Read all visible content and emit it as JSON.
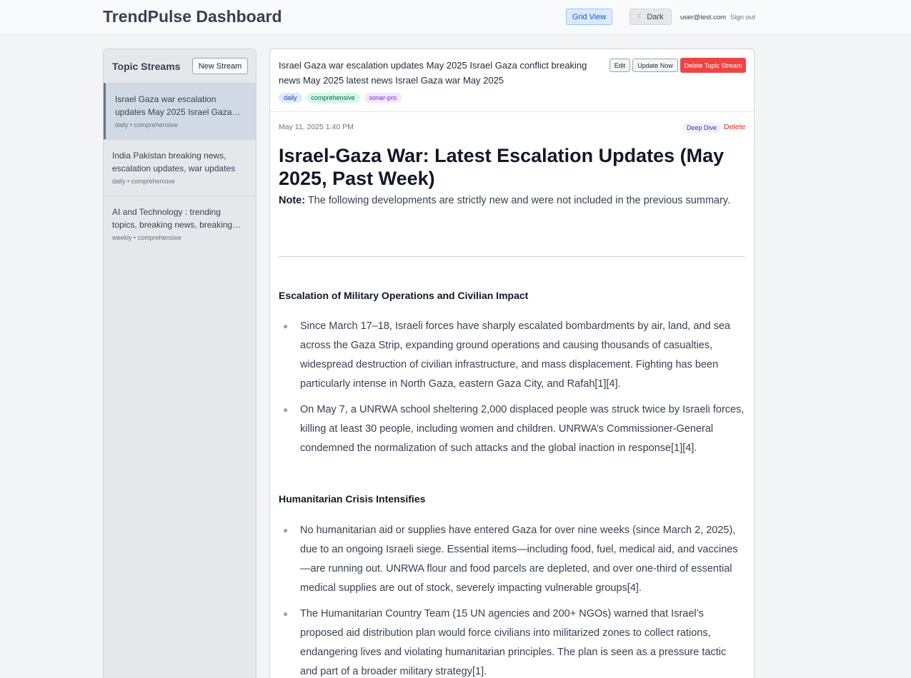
{
  "header": {
    "app_title": "TrendPulse Dashboard",
    "grid_view_label": "Grid View",
    "dark_label": "Dark",
    "user_email": "user@test.com",
    "sign_out_label": "Sign out"
  },
  "sidebar": {
    "title": "Topic Streams",
    "new_stream_label": "New Stream",
    "items": [
      {
        "title": "Israel Gaza war escalation updates May 2025 Israel Gaza conflict breaking news May 2025 latest news Israel Gaza war May 2025",
        "meta": "daily • comprehensive",
        "active": true
      },
      {
        "title": "India Pakistan breaking news, escalation updates, war updates",
        "meta": "daily • comprehensive",
        "active": false
      },
      {
        "title": "AI and Technology : trending topics, breaking news, breaking updates",
        "meta": "weekly • comprehensive",
        "active": false
      }
    ]
  },
  "main": {
    "title": "Israel Gaza war escalation updates May 2025 Israel Gaza conflict breaking news May 2025 latest news Israel Gaza war May 2025",
    "edit_label": "Edit",
    "update_label": "Update Now",
    "delete_topic_label": "Delete Topic Stream",
    "tags": [
      "daily",
      "comprehensive",
      "sonar-pro"
    ],
    "entry": {
      "date": "May 11, 2025 1:40 PM",
      "deep_dive_label": "Deep Dive",
      "delete_label": "Delete",
      "headline": "Israel-Gaza War: Latest Escalation Updates (May 2025, Past Week)",
      "note_label": "Note:",
      "note_text": " The following developments are strictly new and were not included in the previous summary.",
      "sections": [
        {
          "heading": "Escalation of Military Operations and Civilian Impact",
          "bullets": [
            "Since March 17–18, Israeli forces have sharply escalated bombardments by air, land, and sea across the Gaza Strip, expanding ground operations and causing thousands of casualties, widespread destruction of civilian infrastructure, and mass displacement. Fighting has been particularly intense in North Gaza, eastern Gaza City, and Rafah[1][4].",
            "On May 7, a UNRWA school sheltering 2,000 displaced people was struck twice by Israeli forces, killing at least 30 people, including women and children. UNRWA’s Commissioner-General condemned the normalization of such attacks and the global inaction in response[1][4]."
          ]
        },
        {
          "heading": "Humanitarian Crisis Intensifies",
          "bullets": [
            "No humanitarian aid or supplies have entered Gaza for over nine weeks (since March 2, 2025), due to an ongoing Israeli siege. Essential items—including food, fuel, medical aid, and vaccines—are running out. UNRWA flour and food parcels are depleted, and over one-third of essential medical supplies are out of stock, severely impacting vulnerable groups[4].",
            "The Humanitarian Country Team (15 UN agencies and 200+ NGOs) warned that Israel’s proposed aid distribution plan would force civilians into militarized zones to collect rations, endangering lives and violating humanitarian principles. The plan is seen as a pressure tactic and part of a broader military strategy[1]."
          ]
        }
      ]
    }
  }
}
